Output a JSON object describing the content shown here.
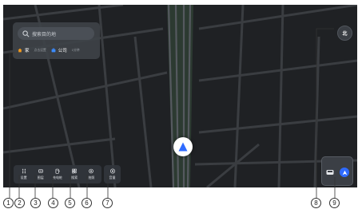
{
  "search": {
    "placeholder": "搜索目的地"
  },
  "quick": {
    "home_label": "家",
    "home_hint": "点击设置",
    "work_label": "公司",
    "work_hint": "1分钟"
  },
  "dock": {
    "items": [
      {
        "label": "设置",
        "icon": "grid-dots-icon"
      },
      {
        "label": "图层",
        "icon": "layers-icon"
      },
      {
        "label": "充电桩",
        "icon": "charger-icon"
      },
      {
        "label": "搜索",
        "icon": "search-icon"
      },
      {
        "label": "拍照",
        "icon": "camera-icon"
      }
    ],
    "volume_label": "音量"
  },
  "compass": {
    "label": "北"
  },
  "callouts": [
    "1",
    "2",
    "3",
    "4",
    "5",
    "6",
    "7",
    "8",
    "9"
  ],
  "colors": {
    "map_bg": "#1f2124",
    "road": "#3a3d41",
    "highway": "#55595f",
    "green": "#2c3a31",
    "accent": "#2f6bff",
    "home_icon": "#f39a1e",
    "work_icon": "#3b8bff"
  }
}
